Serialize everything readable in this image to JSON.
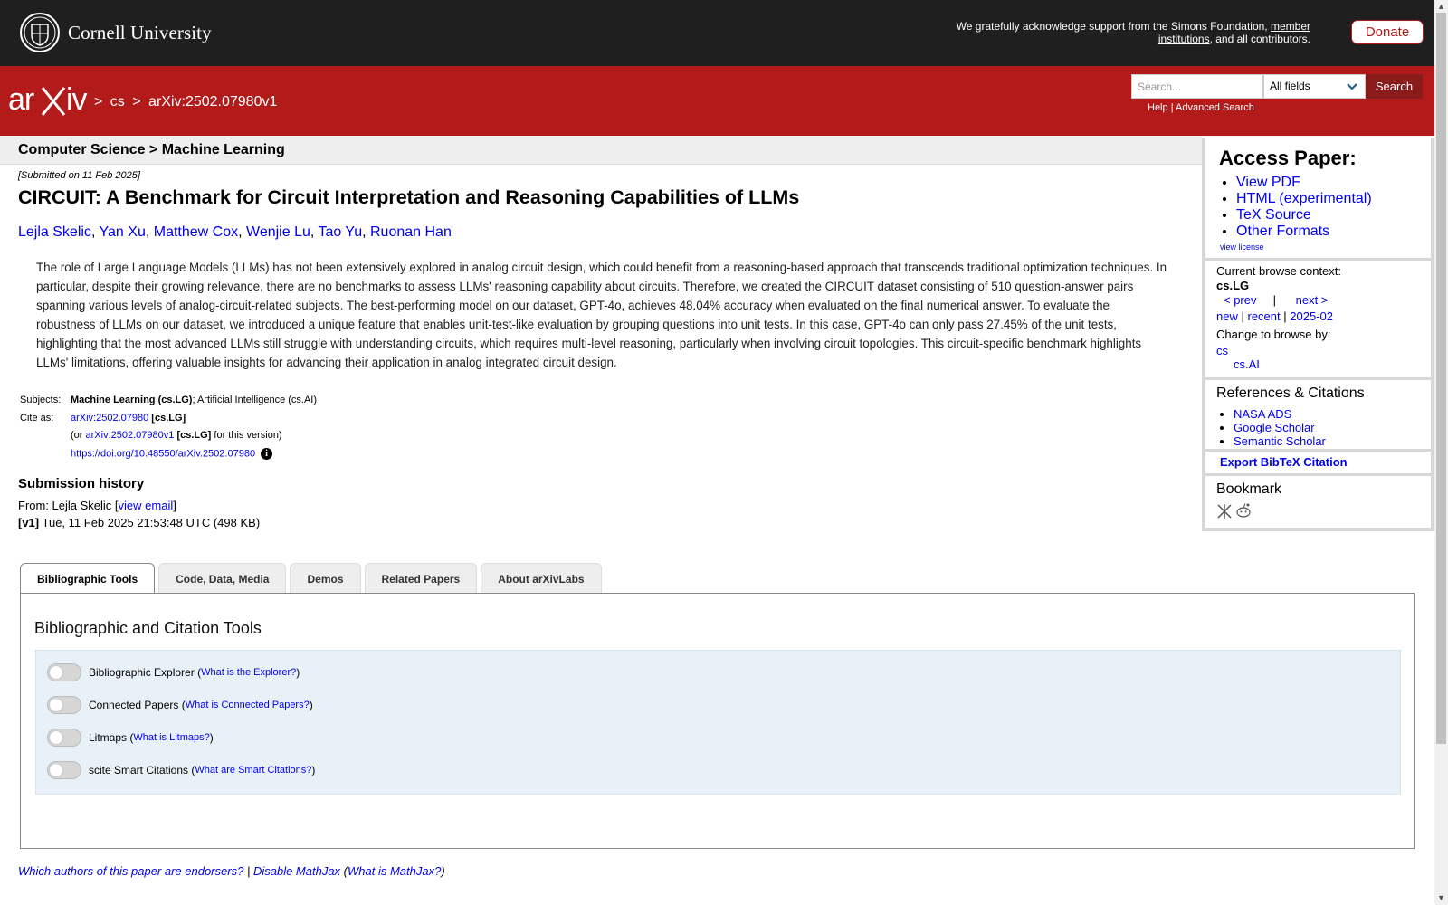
{
  "header": {
    "university": "Cornell University",
    "ack_text": "We gratefully acknowledge support from the Simons Foundation,",
    "ack_link": "member institutions",
    "ack_tail": ", and all contributors.",
    "donate_label": "Donate"
  },
  "nav": {
    "logo_text": "arXiv",
    "crumb_sep": ">",
    "crumb_section": "cs",
    "crumb_paper": "arXiv:2502.07980v1",
    "search_placeholder": "Search...",
    "search_field": "All fields",
    "search_button": "Search",
    "help_label": "Help",
    "link_sep": "|",
    "advanced_label": "Advanced Search"
  },
  "paper": {
    "category": "Computer Science > Machine Learning",
    "submitted": "[Submitted on 11 Feb 2025]",
    "title": "CIRCUIT: A Benchmark for Circuit Interpretation and Reasoning Capabilities of LLMs",
    "authors": [
      "Lejla Skelic",
      "Yan Xu",
      "Matthew Cox",
      "Wenjie Lu",
      "Tao Yu",
      "Ruonan Han"
    ],
    "abstract": "The role of Large Language Models (LLMs) has not been extensively explored in analog circuit design, which could benefit from a reasoning-based approach that transcends traditional optimization techniques. In particular, despite their growing relevance, there are no benchmarks to assess LLMs' reasoning capability about circuits. Therefore, we created the CIRCUIT dataset consisting of 510 question-answer pairs spanning various levels of analog-circuit-related subjects. The best-performing model on our dataset, GPT-4o, achieves 48.04% accuracy when evaluated on the final numerical answer. To evaluate the robustness of LLMs on our dataset, we introduced a unique feature that enables unit-test-like evaluation by grouping questions into unit tests. In this case, GPT-4o can only pass 27.45% of the unit tests, highlighting that the most advanced LLMs still struggle with understanding circuits, which requires multi-level reasoning, particularly when involving circuit topologies. This circuit-specific benchmark highlights LLMs' limitations, offering valuable insights for advancing their application in analog integrated circuit design."
  },
  "meta": {
    "subjects_label": "Subjects:",
    "subject_primary": "Machine Learning (cs.LG)",
    "subject_secondary": "; Artificial Intelligence (cs.AI)",
    "cite_label": "Cite as:",
    "cite_id": "arXiv:2502.07980",
    "cite_cat": "[cs.LG]",
    "cite_or": "(or",
    "cite_version": "arXiv:2502.07980v1",
    "cite_version_cat": "[cs.LG]",
    "cite_version_tail": "for this version)",
    "doi": "https://doi.org/10.48550/arXiv.2502.07980"
  },
  "history": {
    "title": "Submission history",
    "from_prefix": "From: Lejla Skelic [",
    "view_email": "view email",
    "from_suffix": "]",
    "v1_label": "[v1]",
    "v1_text": "Tue, 11 Feb 2025 21:53:48 UTC (498 KB)"
  },
  "sidebar": {
    "access_title": "Access Paper:",
    "access_links": [
      "View PDF",
      "HTML (experimental)",
      "TeX Source",
      "Other Formats"
    ],
    "view_license": "view license",
    "context_label": "Current browse context:",
    "context_value": "cs.LG",
    "prev": "< prev",
    "pipe": "|",
    "next": "next >",
    "new": "new",
    "recent": "recent",
    "month": "2025-02",
    "change_label": "Change to browse by:",
    "browse_cs": "cs",
    "browse_ai": "cs.AI",
    "refs_title": "References & Citations",
    "refs": [
      "NASA ADS",
      "Google Scholar",
      "Semantic Scholar"
    ],
    "export": "Export BibTeX Citation",
    "bookmark_title": "Bookmark"
  },
  "tabs": {
    "items": [
      "Bibliographic Tools",
      "Code, Data, Media",
      "Demos",
      "Related Papers",
      "About arXivLabs"
    ],
    "active_index": 0,
    "panel_title": "Bibliographic and Citation Tools",
    "tools": [
      {
        "label": "Bibliographic Explorer",
        "link": "What is the Explorer?"
      },
      {
        "label": "Connected Papers",
        "link": "What is Connected Papers?"
      },
      {
        "label": "Litmaps",
        "link": "What is Litmaps?"
      },
      {
        "label": "scite Smart Citations",
        "link": "What are Smart Citations?"
      }
    ]
  },
  "footer": {
    "endorsers": "Which authors of this paper are endorsers?",
    "sep": "|",
    "mathjax": "Disable MathJax",
    "whatmathjax": "What is MathJax?"
  },
  "colors": {
    "arxiv_red": "#b31b1b",
    "top_bar": "#1f1f1f",
    "link": "#0000ee"
  }
}
